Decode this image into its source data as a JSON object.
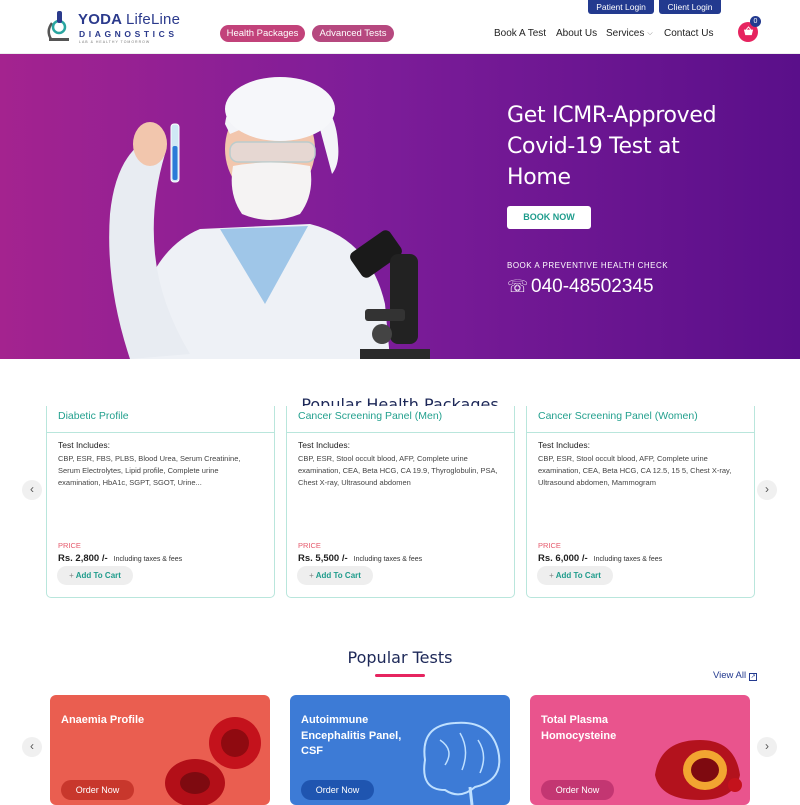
{
  "header": {
    "logo": {
      "name_bold": "YODA",
      "name_light": "LifeLine",
      "sub": "DIAGNOSTICS",
      "tag": "LAB & HEALTHY TOMORROW"
    },
    "pills": [
      "Health Packages",
      "Advanced Tests"
    ],
    "logins": [
      "Patient Login",
      "Client Login"
    ],
    "nav": [
      "Book A Test",
      "About Us",
      "Services",
      "Contact Us"
    ],
    "cart_count": "0"
  },
  "hero": {
    "title": "Get ICMR-Approved Covid-19 Test at Home",
    "cta": "BOOK NOW",
    "preventive": "BOOK A PREVENTIVE HEALTH CHECK",
    "phone": "040-48502345"
  },
  "packages": {
    "section_title": "Popular Health Packages",
    "includes_label": "Test Includes:",
    "price_label": "PRICE",
    "tax_note": "Including taxes & fees",
    "add_to_cart": "Add To Cart",
    "items": [
      {
        "title": "Diabetic Profile",
        "includes": "CBP, ESR, FBS, PLBS, Blood Urea, Serum Creatinine, Serum Electrolytes, Lipid profile, Complete urine examination, HbA1c, SGPT, SGOT, Urine...",
        "price": "Rs. 2,800 /-"
      },
      {
        "title": "Cancer Screening Panel (Men)",
        "includes": "CBP, ESR, Stool occult blood, AFP, Complete urine examination, CEA, Beta HCG, CA 19.9, Thyroglobulin, PSA, Chest X-ray, Ultrasound abdomen",
        "price": "Rs. 5,500 /-"
      },
      {
        "title": "Cancer Screening Panel (Women)",
        "includes": "CBP, ESR, Stool occult blood, AFP, Complete urine examination, CEA, Beta HCG, CA 12.5, 15 5, Chest X-ray, Ultrasound abdomen, Mammogram",
        "price": "Rs. 6,000 /-"
      }
    ]
  },
  "tests": {
    "section_title": "Popular Tests",
    "view_all": "View All",
    "order_label": "Order Now",
    "items": [
      {
        "name": "Anaemia Profile"
      },
      {
        "name": "Autoimmune Encephalitis Panel, CSF"
      },
      {
        "name": "Total Plasma Homocysteine"
      }
    ]
  },
  "colors": {
    "brand_navy": "#233a8f",
    "brand_pink": "#e6245f",
    "teal": "#23a08e",
    "hero_purple": "#7e1d99"
  }
}
